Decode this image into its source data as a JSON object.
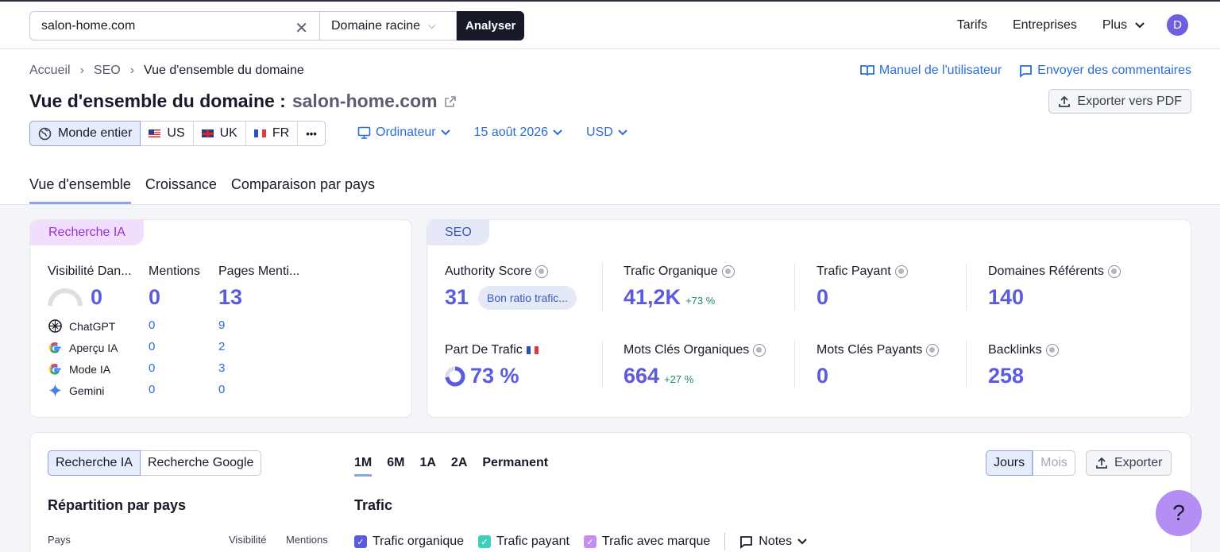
{
  "topbar": {
    "search_value": "salon-home.com",
    "scope": "Domaine racine",
    "analyze": "Analyser",
    "nav": [
      "Tarifs",
      "Entreprises",
      "Plus"
    ],
    "avatar": "D"
  },
  "breadcrumb": [
    "Accueil",
    "SEO",
    "Vue d'ensemble du domaine"
  ],
  "header_links": {
    "manual": "Manuel de l'utilisateur",
    "feedback": "Envoyer des commentaires"
  },
  "title": {
    "prefix": "Vue d'ensemble du domaine :",
    "domain": "salon-home.com"
  },
  "export_pdf": "Exporter vers PDF",
  "countries": {
    "world": "Monde entier",
    "us": "US",
    "uk": "UK",
    "fr": "FR",
    "more": "•••"
  },
  "filters": {
    "device": "Ordinateur",
    "date": "15 août 2026",
    "currency": "USD"
  },
  "tabs": [
    "Vue d'ensemble",
    "Croissance",
    "Comparaison par pays"
  ],
  "ai_card": {
    "badge": "Recherche IA",
    "headers": [
      "Visibilité Dan...",
      "Mentions",
      "Pages Menti..."
    ],
    "totals": [
      "0",
      "0",
      "13"
    ],
    "rows": [
      {
        "name": "ChatGPT",
        "mentions": "0",
        "pages": "9"
      },
      {
        "name": "Aperçu IA",
        "mentions": "0",
        "pages": "2"
      },
      {
        "name": "Mode IA",
        "mentions": "0",
        "pages": "3"
      },
      {
        "name": "Gemini",
        "mentions": "0",
        "pages": "0"
      }
    ]
  },
  "seo_card": {
    "badge": "SEO",
    "authority_label": "Authority Score",
    "authority_value": "31",
    "authority_pill": "Bon ratio trafic...",
    "organic_label": "Trafic Organique",
    "organic_value": "41,2K",
    "organic_delta": "+73 %",
    "paid_label": "Trafic Payant",
    "paid_value": "0",
    "refdom_label": "Domaines Référents",
    "refdom_value": "140",
    "share_label": "Part De Trafic",
    "share_value": "73 %",
    "share_fraction": 0.73,
    "org_kw_label": "Mots Clés Organiques",
    "org_kw_value": "664",
    "org_kw_delta": "+27 %",
    "paid_kw_label": "Mots Clés Payants",
    "paid_kw_value": "0",
    "backlinks_label": "Backlinks",
    "backlinks_value": "258"
  },
  "bottom": {
    "source_toggle": [
      "Recherche IA",
      "Recherche Google"
    ],
    "periods": [
      "1M",
      "6M",
      "1A",
      "2A",
      "Permanent"
    ],
    "units": [
      "Jours",
      "Mois"
    ],
    "export": "Exporter",
    "country_title": "Répartition par pays",
    "traffic_title": "Trafic",
    "col_country": "Pays",
    "col_visibility": "Visibilité",
    "col_mentions": "Mentions",
    "legend": [
      "Trafic organique",
      "Trafic payant",
      "Trafic avec marque"
    ],
    "notes": "Notes"
  },
  "colors": {
    "accent": "#5b5be0",
    "link": "#2a6dd9",
    "organic": "#5b5be0",
    "paid": "#3ccfbd",
    "brand": "#c58cf2"
  },
  "help": "?"
}
